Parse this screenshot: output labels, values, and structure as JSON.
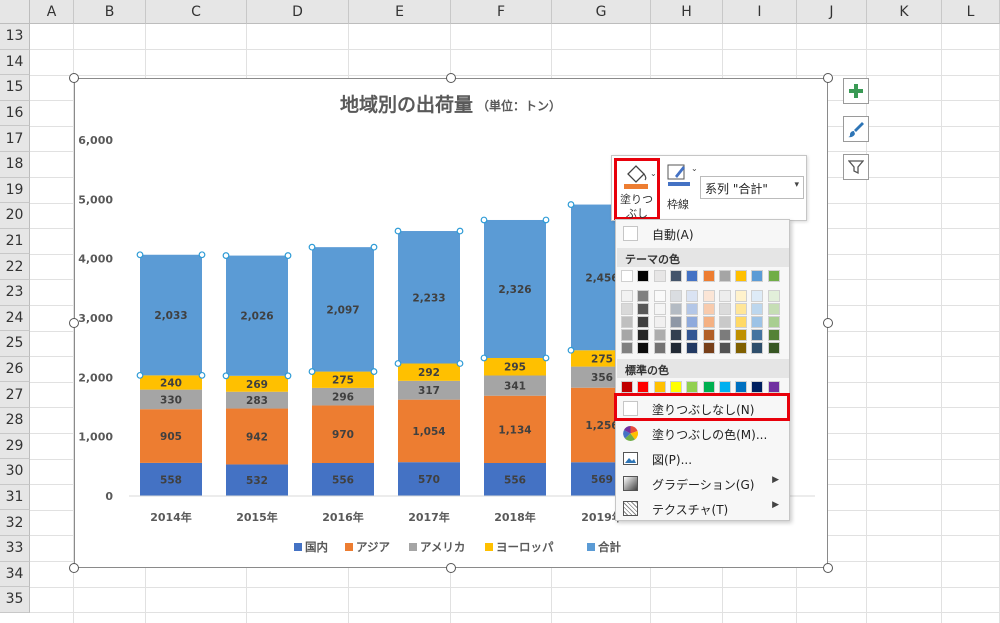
{
  "columns": [
    "A",
    "B",
    "C",
    "D",
    "E",
    "F",
    "G",
    "H",
    "I",
    "J",
    "K",
    "L"
  ],
  "rows": [
    "13",
    "14",
    "15",
    "16",
    "17",
    "18",
    "19",
    "20",
    "21",
    "22",
    "23",
    "24",
    "25",
    "26",
    "27",
    "28",
    "29",
    "30",
    "31",
    "32",
    "33",
    "34",
    "35"
  ],
  "chart_data": {
    "type": "bar",
    "stacked": true,
    "title": "地域別の出荷量",
    "subtitle": "（単位：トン）",
    "categories": [
      "2014年",
      "2015年",
      "2016年",
      "2017年",
      "2018年",
      "2019年",
      ""
    ],
    "ylim": [
      0,
      6000
    ],
    "yticks": [
      "0",
      "1,000",
      "2,000",
      "3,000",
      "4,000",
      "5,000",
      "6,000"
    ],
    "legend_position": "bottom",
    "grid": false,
    "series": [
      {
        "name": "国内",
        "color": "#4472c4",
        "values": [
          558,
          532,
          556,
          570,
          556,
          569
        ],
        "labels": [
          "558",
          "532",
          "556",
          "570",
          "556",
          "569"
        ]
      },
      {
        "name": "アジア",
        "color": "#ed7d31",
        "values": [
          905,
          942,
          970,
          1054,
          1134,
          1256
        ],
        "labels": [
          "905",
          "942",
          "970",
          "1,054",
          "1,134",
          "1,256"
        ]
      },
      {
        "name": "アメリカ",
        "color": "#a5a5a5",
        "values": [
          330,
          283,
          296,
          317,
          341,
          356
        ],
        "labels": [
          "330",
          "283",
          "296",
          "317",
          "341",
          "356"
        ]
      },
      {
        "name": "ヨーロッパ",
        "color": "#ffc000",
        "values": [
          240,
          269,
          275,
          292,
          295,
          275
        ],
        "labels": [
          "240",
          "269",
          "275",
          "292",
          "295",
          "275"
        ]
      },
      {
        "name": "合計",
        "color": "#5b9bd5",
        "values": [
          2033,
          2026,
          2097,
          2233,
          2326,
          2456
        ],
        "labels": [
          "2,033",
          "2,026",
          "2,097",
          "2,233",
          "2,326",
          "2,456"
        ]
      }
    ]
  },
  "minibar": {
    "fill_label_line1": "塗りつ",
    "fill_label_line2": "ぶし",
    "border_label": "枠線",
    "series_value": "系列 \"合計\""
  },
  "menu": {
    "auto": "自動(A)",
    "theme_colors": "テーマの色",
    "standard_colors": "標準の色",
    "no_fill": "塗りつぶしなし(N)",
    "more_colors": "塗りつぶしの色(M)...",
    "picture": "図(P)...",
    "gradient": "グラデーション(G)",
    "texture": "テクスチャ(T)",
    "theme_row": [
      "#ffffff",
      "#000000",
      "#e7e6e6",
      "#44546a",
      "#4472c4",
      "#ed7d31",
      "#a5a5a5",
      "#ffc000",
      "#5b9bd5",
      "#70ad47"
    ],
    "standard_row": [
      "#c00000",
      "#ff0000",
      "#ffc000",
      "#ffff00",
      "#92d050",
      "#00b050",
      "#00b0f0",
      "#0070c0",
      "#002060",
      "#7030a0"
    ]
  }
}
